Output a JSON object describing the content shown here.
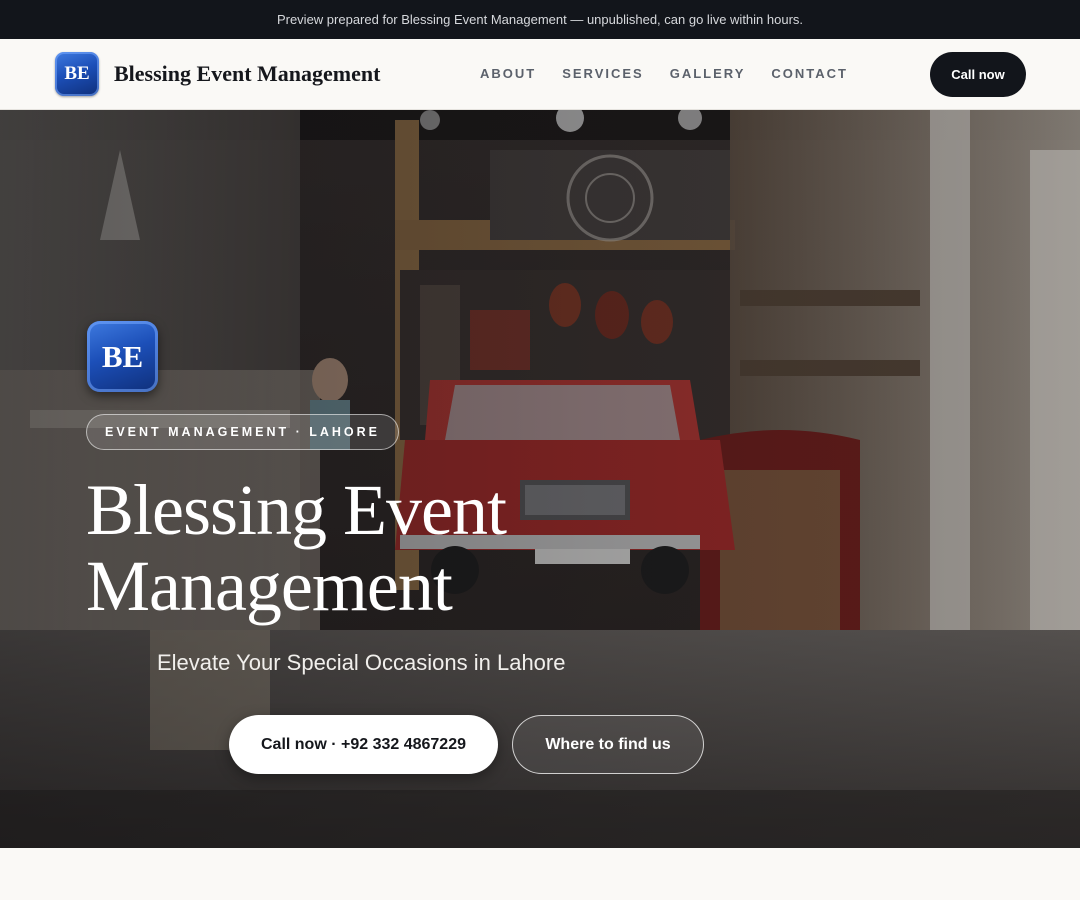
{
  "preview_banner": {
    "text": "Preview prepared for Blessing Event Management — unpublished, can go live within hours."
  },
  "nav": {
    "logo_initials": "BE",
    "brand_name": "Blessing Event Management",
    "links": [
      "ABOUT",
      "SERVICES",
      "GALLERY",
      "CONTACT"
    ],
    "cta_label": "Call now"
  },
  "hero": {
    "logo_initials": "BE",
    "eyebrow": "EVENT MANAGEMENT · LAHORE",
    "title": "Blessing Event Management",
    "subtitle": "Elevate Your Special Occasions in Lahore",
    "primary_button": "Call now · +92 332 4867229",
    "secondary_button": "Where to find us",
    "background_image": "shop-interior-with-red-car-photo"
  },
  "colors": {
    "dark": "#12151b",
    "page_bg": "#faf9f6",
    "logo_blue": "#1c4fb8",
    "white": "#ffffff"
  }
}
